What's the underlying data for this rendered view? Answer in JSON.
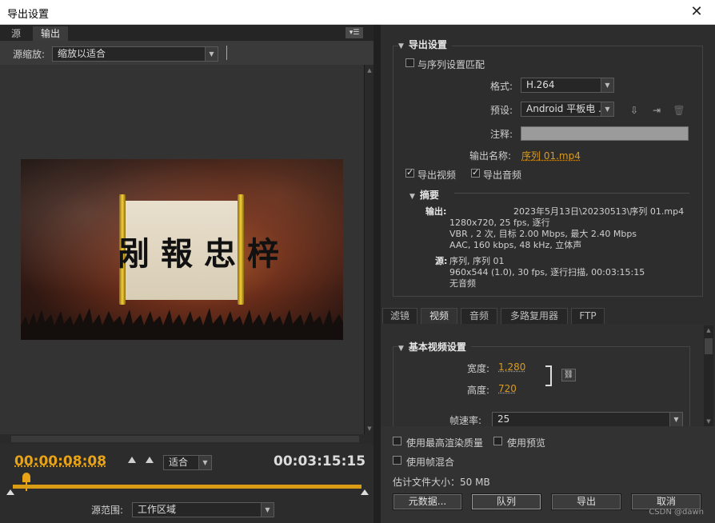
{
  "window": {
    "title": "导出设置",
    "close_glyph": "✕"
  },
  "left": {
    "tabs": [
      {
        "label": "源"
      },
      {
        "label": "输出"
      }
    ],
    "panel_menu_glyph": "▾☰",
    "source_scale": {
      "label": "源缩放:",
      "value": "缩放以适合"
    },
    "preview": {
      "calligraphy": "剐報忠梓"
    },
    "timecode_current": "00:00:08:08",
    "fit": {
      "value": "适合"
    },
    "timecode_duration": "00:03:15:15",
    "source_range": {
      "label": "源范围:",
      "value": "工作区域"
    }
  },
  "right": {
    "export_settings": {
      "title": "导出设置",
      "match_sequence": "与序列设置匹配",
      "format_label": "格式:",
      "format_value": "H.264",
      "preset_label": "预设:",
      "preset_value": "Android 平板电 ...",
      "comment_label": "注释:",
      "output_name_label": "输出名称:",
      "output_name_value": "序列 01.mp4",
      "export_video": "导出视频",
      "export_audio": "导出音频"
    },
    "summary": {
      "title": "摘要",
      "output_label": "输出:",
      "output_lines": [
        "2023年5月13日\\20230513\\序列 01.mp4",
        "1280x720, 25 fps, 逐行",
        "VBR , 2 次, 目标 2.00 Mbps, 最大 2.40 Mbps",
        "AAC, 160 kbps, 48 kHz, 立体声"
      ],
      "source_label": "源:",
      "source_lines": [
        "序列, 序列 01",
        "960x544 (1.0), 30 fps, 逐行扫描, 00:03:15:15",
        "无音频"
      ]
    },
    "tabs": [
      {
        "label": "滤镜"
      },
      {
        "label": "视频"
      },
      {
        "label": "音频"
      },
      {
        "label": "多路复用器"
      },
      {
        "label": "FTP"
      }
    ],
    "basic_video": {
      "title": "基本视频设置",
      "width_label": "宽度:",
      "width_value": "1,280",
      "height_label": "高度:",
      "height_value": "720",
      "framerate_label": "帧速率:",
      "framerate_value": "25"
    },
    "options": {
      "max_render": "使用最高渲染质量",
      "use_preview": "使用预览",
      "frame_blend": "使用帧混合",
      "file_size": "估计文件大小：50 MB"
    },
    "buttons": {
      "metadata": "元数据...",
      "queue": "队列",
      "export": "导出",
      "cancel": "取消"
    },
    "watermark": "CSDN @dawn"
  }
}
